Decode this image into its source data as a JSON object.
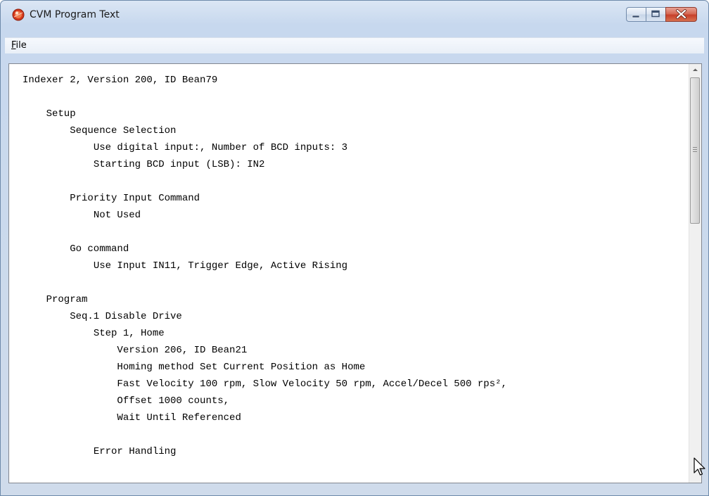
{
  "window": {
    "title": "CVM Program Text",
    "app_icon": "cvm-app-icon",
    "caption_buttons": [
      "minimize",
      "maximize",
      "close"
    ]
  },
  "menu": {
    "file_mnemonic": "F",
    "file_rest": "ile"
  },
  "program_text": {
    "lines": [
      {
        "indent": 0,
        "text": "Indexer 2, Version 200, ID Bean79"
      },
      {
        "indent": 0,
        "text": ""
      },
      {
        "indent": 1,
        "text": "Setup"
      },
      {
        "indent": 2,
        "text": "Sequence Selection"
      },
      {
        "indent": 3,
        "text": "Use digital input:, Number of BCD inputs: 3"
      },
      {
        "indent": 3,
        "text": "Starting BCD input (LSB): IN2"
      },
      {
        "indent": 0,
        "text": ""
      },
      {
        "indent": 2,
        "text": "Priority Input Command"
      },
      {
        "indent": 3,
        "text": "Not Used"
      },
      {
        "indent": 0,
        "text": ""
      },
      {
        "indent": 2,
        "text": "Go command"
      },
      {
        "indent": 3,
        "text": "Use Input IN11, Trigger Edge, Active Rising"
      },
      {
        "indent": 0,
        "text": ""
      },
      {
        "indent": 1,
        "text": "Program"
      },
      {
        "indent": 2,
        "text": "Seq.1 Disable Drive"
      },
      {
        "indent": 3,
        "text": "Step 1, Home"
      },
      {
        "indent": 4,
        "text": "Version 206, ID Bean21"
      },
      {
        "indent": 4,
        "text": "Homing method Set Current Position as Home"
      },
      {
        "indent": 4,
        "text": "Fast Velocity 100 rpm, Slow Velocity 50 rpm, Accel/Decel 500 rps²,"
      },
      {
        "indent": 4,
        "text": "Offset 1000 counts,"
      },
      {
        "indent": 4,
        "text": "Wait Until Referenced"
      },
      {
        "indent": 0,
        "text": ""
      },
      {
        "indent": 3,
        "text": "Error Handling"
      }
    ]
  },
  "colors": {
    "close_button": "#c7402a",
    "frame": "#c7d8ee",
    "text_bg": "#ffffff"
  }
}
